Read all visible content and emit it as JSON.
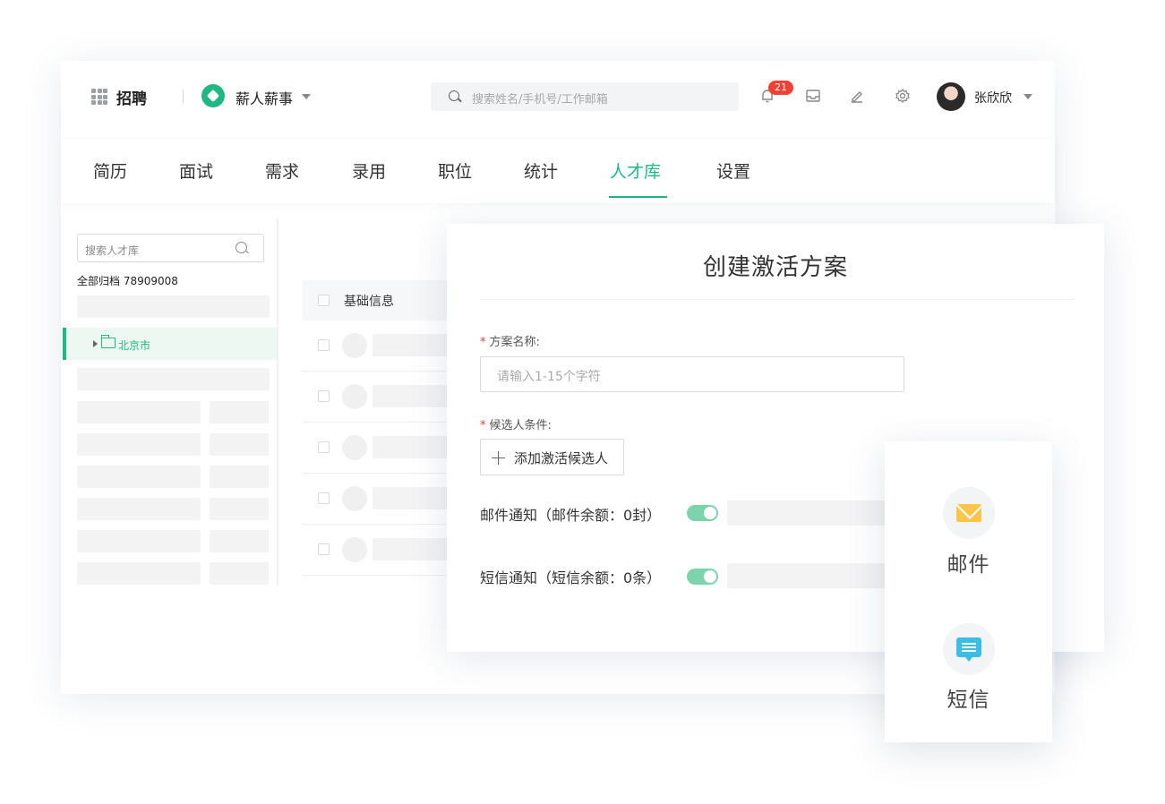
{
  "topbar": {
    "app_name": "招聘",
    "brand_name": "薪人薪事",
    "search_placeholder": "搜索姓名/手机号/工作邮箱",
    "notification_count": "21",
    "user_name": "张欣欣"
  },
  "nav": {
    "tabs": [
      {
        "label": "简历"
      },
      {
        "label": "面试"
      },
      {
        "label": "需求"
      },
      {
        "label": "录用"
      },
      {
        "label": "职位"
      },
      {
        "label": "统计"
      },
      {
        "label": "人才库",
        "active": true
      },
      {
        "label": "设置"
      }
    ]
  },
  "sidebar": {
    "search_placeholder": "搜索人才库",
    "archive_label": "全部归档 78909008",
    "tree_item": "北京市"
  },
  "list": {
    "header_label": "基础信息"
  },
  "modal": {
    "title": "创建激活方案",
    "name_label": "方案名称:",
    "name_placeholder": "请输入1-15个字符",
    "candidate_label": "候选人条件:",
    "add_button": "添加激活候选人",
    "email_notice": "邮件通知（邮件余额：0封）",
    "sms_notice": "短信通知（短信余额：0条）",
    "required_mark": "*",
    "email_toggle_on": true,
    "sms_toggle_on": true
  },
  "float_card": {
    "email_label": "邮件",
    "sms_label": "短信"
  },
  "colors": {
    "accent": "#1fb883",
    "badge": "#f04134",
    "toggle": "#7dd4ac",
    "mail_icon": "#ffc54a",
    "sms_icon": "#3bbde6"
  },
  "icons": [
    "grid-icon",
    "brand-logo",
    "search-icon",
    "bell-icon",
    "inbox-icon",
    "edit-icon",
    "gear-icon",
    "folder-icon",
    "plus-icon",
    "mail-icon",
    "sms-icon"
  ]
}
